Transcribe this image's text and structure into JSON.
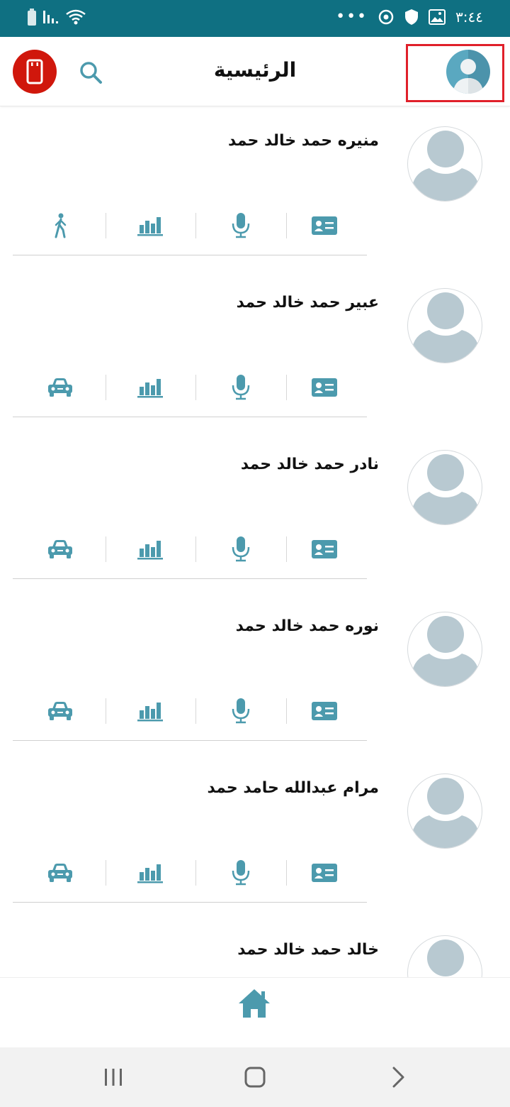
{
  "status_bar": {
    "time": "٣:٤٤",
    "more": "•••",
    "bg_color": "#0f7082"
  },
  "header": {
    "title": "الرئيسية",
    "icons": [
      "logout-icon",
      "search-icon",
      "profile-avatar-icon"
    ],
    "logout_color": "#d0170c",
    "accent": "#4c9aad"
  },
  "contacts": [
    {
      "name": "منيره حمد خالد حمد",
      "actions": [
        "id-card-icon",
        "microphone-icon",
        "bar-chart-icon",
        "walking-icon"
      ]
    },
    {
      "name": "عبير حمد خالد حمد",
      "actions": [
        "id-card-icon",
        "microphone-icon",
        "bar-chart-icon",
        "car-icon"
      ]
    },
    {
      "name": "نادر حمد خالد حمد",
      "actions": [
        "id-card-icon",
        "microphone-icon",
        "bar-chart-icon",
        "car-icon"
      ]
    },
    {
      "name": "نوره حمد خالد حمد",
      "actions": [
        "id-card-icon",
        "microphone-icon",
        "bar-chart-icon",
        "car-icon"
      ]
    },
    {
      "name": "مرام عبدالله حامد حمد",
      "actions": [
        "id-card-icon",
        "microphone-icon",
        "bar-chart-icon",
        "car-icon"
      ]
    },
    {
      "name": "خالد حمد خالد حمد",
      "actions": []
    }
  ],
  "bottom_bar": {
    "icon": "home-icon"
  },
  "nav_bar": {
    "icons": [
      "recent-apps-icon",
      "home-nav-icon",
      "back-icon"
    ]
  }
}
